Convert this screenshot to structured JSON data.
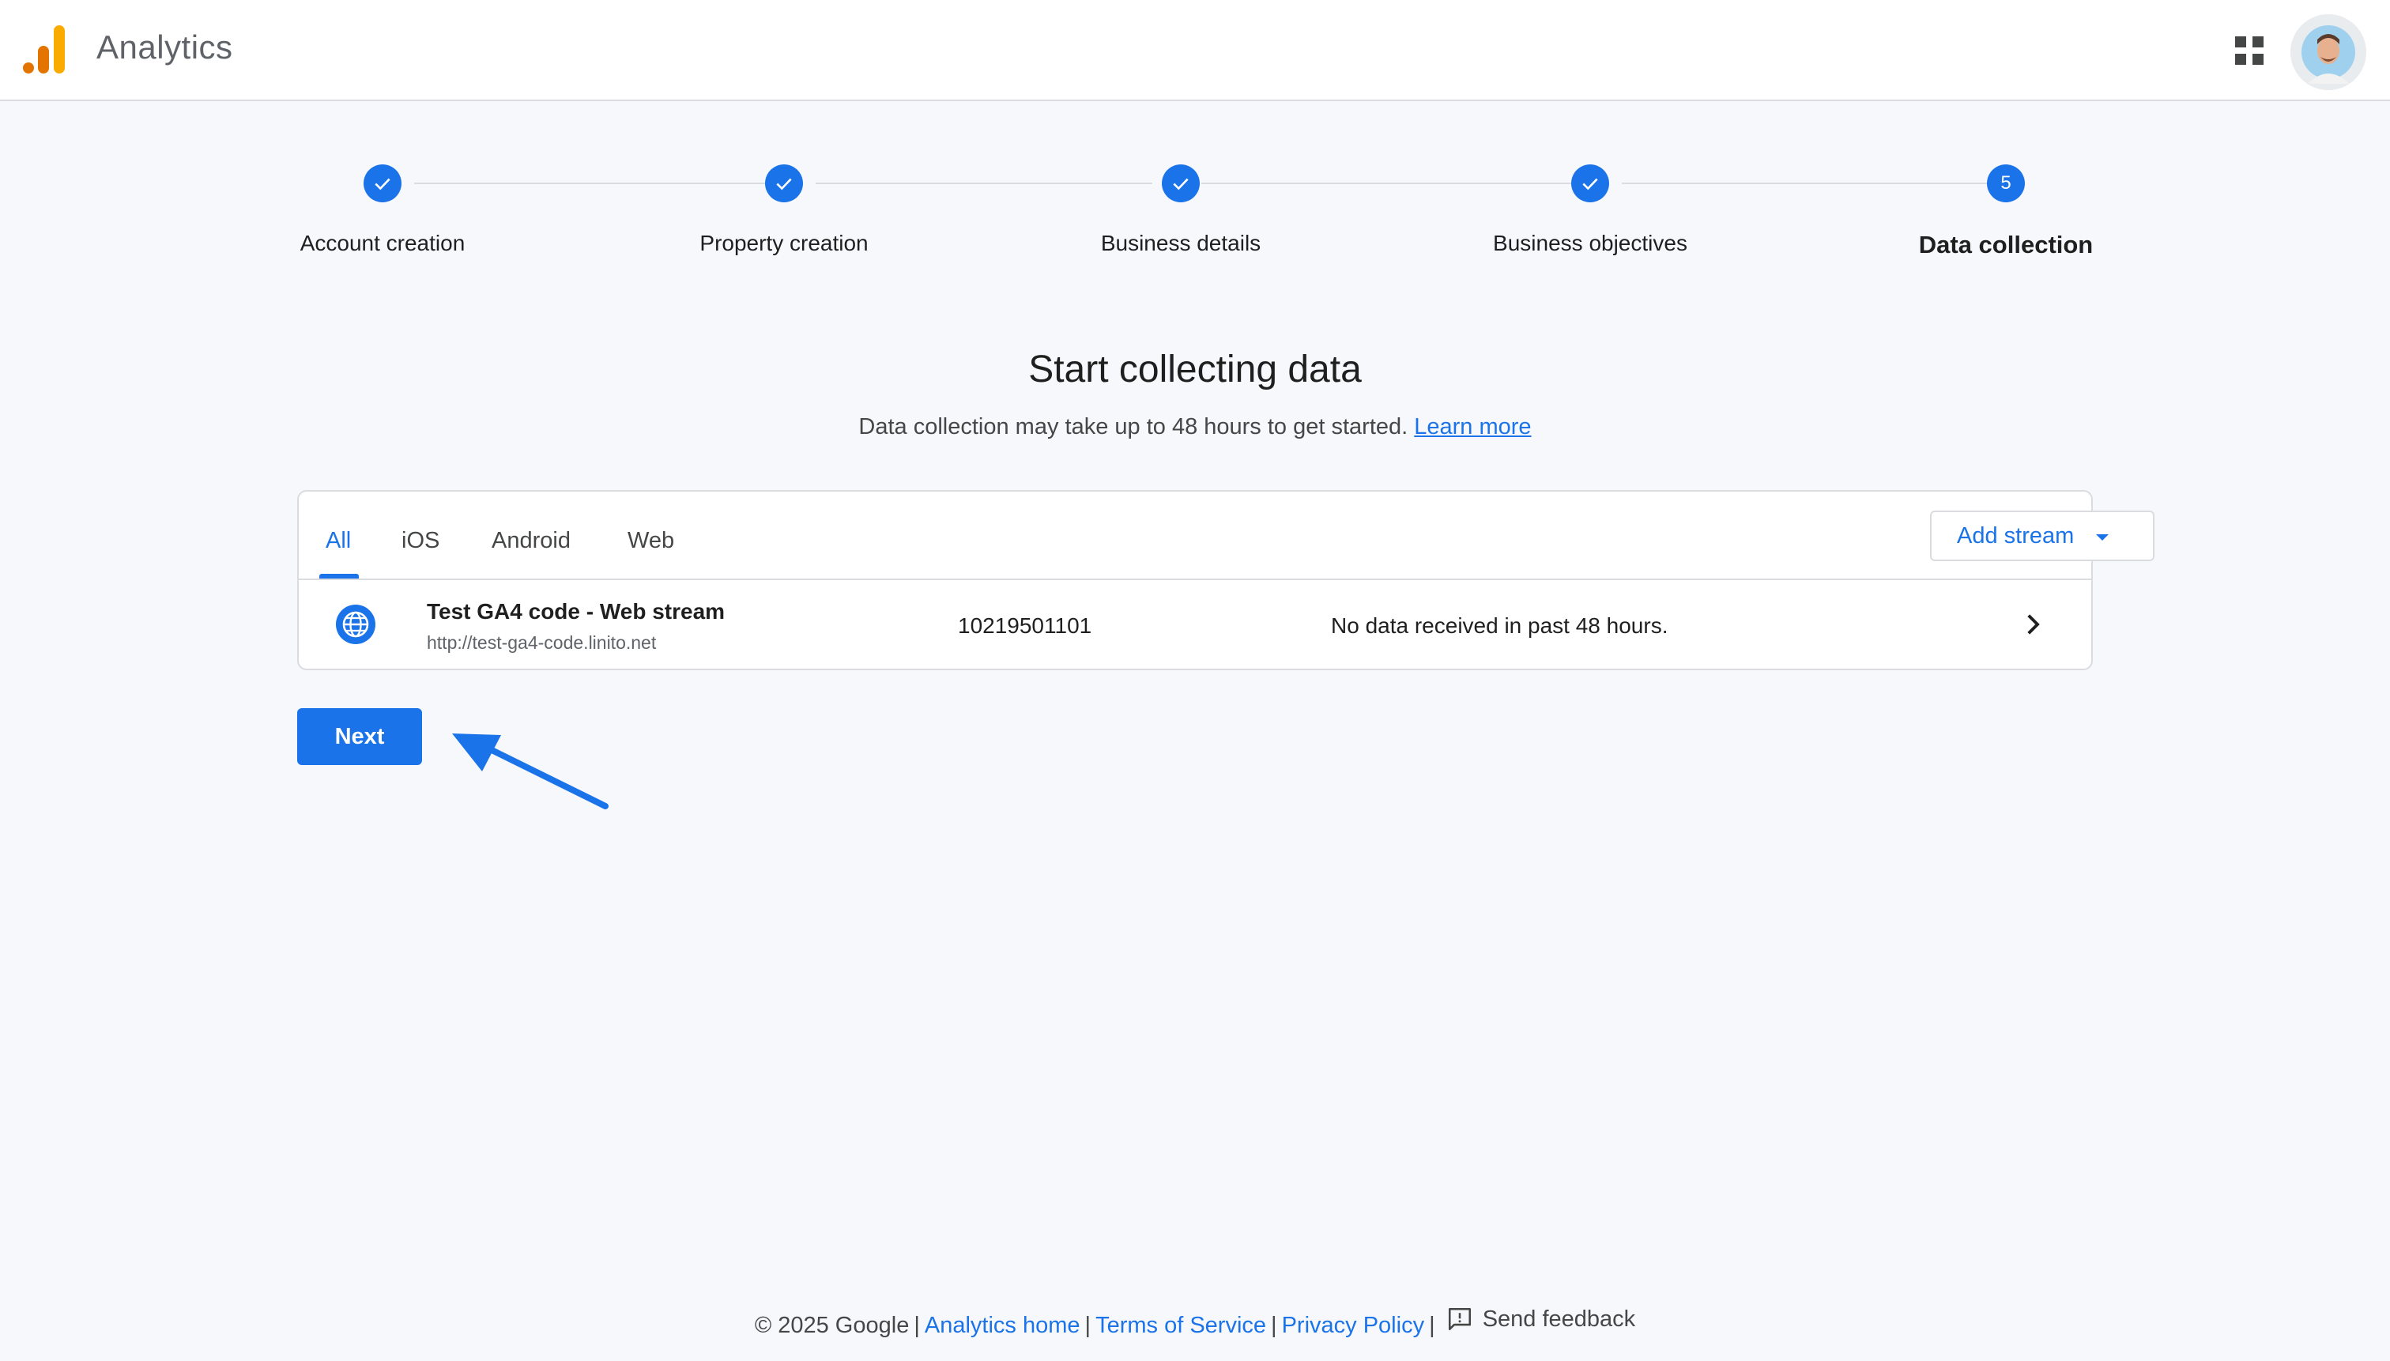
{
  "header": {
    "app_title": "Analytics",
    "logo_icon": "analytics-logo-icon",
    "apps_icon": "google-apps-icon",
    "avatar_icon": "user-avatar-icon",
    "logo_colors": [
      "#f9ab00",
      "#e37400"
    ]
  },
  "stepper": {
    "steps": [
      {
        "label": "Account creation",
        "state": "completed",
        "icon": "check-icon"
      },
      {
        "label": "Property creation",
        "state": "completed",
        "icon": "check-icon"
      },
      {
        "label": "Business details",
        "state": "completed",
        "icon": "check-icon"
      },
      {
        "label": "Business objectives",
        "state": "completed",
        "icon": "check-icon"
      },
      {
        "label": "Data collection",
        "state": "current",
        "number": "5"
      }
    ]
  },
  "main": {
    "title": "Start collecting data",
    "subtitle": "Data collection may take up to 48 hours to get started.",
    "learn_more": "Learn more"
  },
  "streams_card": {
    "tabs": [
      {
        "label": "All",
        "active": true
      },
      {
        "label": "iOS",
        "active": false
      },
      {
        "label": "Android",
        "active": false
      },
      {
        "label": "Web",
        "active": false
      }
    ],
    "add_stream_label": "Add stream",
    "rows": [
      {
        "icon": "globe-icon",
        "name": "Test GA4 code - Web stream",
        "url": "http://test-ga4-code.linito.net",
        "stream_id": "10219501101",
        "status": "No data received in past 48 hours."
      }
    ]
  },
  "actions": {
    "next_label": "Next",
    "annotation_arrow_color": "#1a73e8"
  },
  "footer": {
    "copyright": "© 2025 Google",
    "analytics_home": "Analytics home",
    "terms": "Terms of Service",
    "privacy": "Privacy Policy",
    "feedback": "Send feedback"
  },
  "colors": {
    "accent": "#1a73e8",
    "background": "#f7f8fb",
    "border": "#dadce0"
  }
}
